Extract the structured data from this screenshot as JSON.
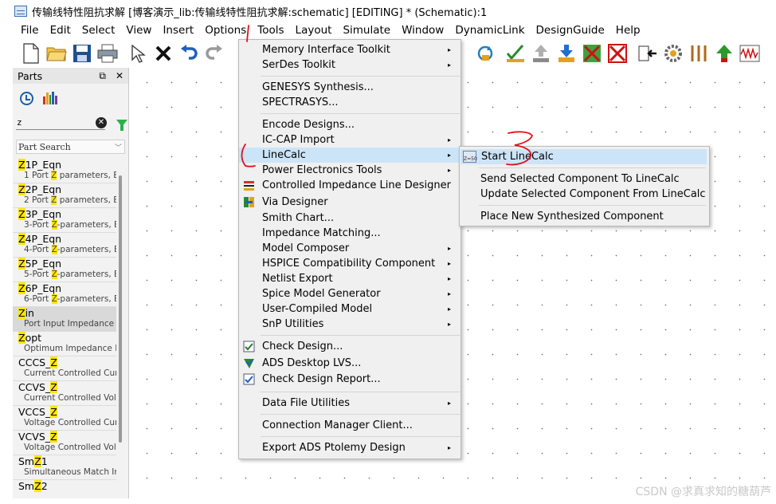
{
  "window": {
    "title": "传输线特性阻抗求解 [博客演示_lib:传输线特性阻抗求解:schematic] [EDITING] * (Schematic):1"
  },
  "menubar": {
    "items": [
      "File",
      "Edit",
      "Select",
      "View",
      "Insert",
      "Options",
      "Tools",
      "Layout",
      "Simulate",
      "Window",
      "DynamicLink",
      "DesignGuide",
      "Help"
    ]
  },
  "toolbar": {
    "icons": [
      "new-document-icon",
      "open-folder-icon",
      "save-icon",
      "print-icon",
      "select-arrow-icon",
      "delete-x-icon",
      "undo-icon",
      "redo-icon",
      "route-icon",
      "checklist-icon",
      "upload-icon",
      "download-icon",
      "deactivate-icon",
      "deactivate-short-icon",
      "export-icon",
      "gear-icon",
      "tuning-icon",
      "push-up-icon",
      "waveform-icon"
    ]
  },
  "parts_panel": {
    "title": "Parts",
    "float_glyph": "⧉",
    "close_glyph": "✕",
    "search_value": "z",
    "part_search_label": "Part Search",
    "items": [
      {
        "pre": "",
        "hl": "Z",
        "post": "1P_Eqn",
        "desc_pre": "1 Port ",
        "desc_hl": "Z",
        "desc_post": " parameters, Eq"
      },
      {
        "pre": "",
        "hl": "Z",
        "post": "2P_Eqn",
        "desc_pre": "2 Port ",
        "desc_hl": "Z",
        "desc_post": " parameters, Eq"
      },
      {
        "pre": "",
        "hl": "Z",
        "post": "3P_Eqn",
        "desc_pre": "3-Port ",
        "desc_hl": "Z",
        "desc_post": "-parameters, Eq"
      },
      {
        "pre": "",
        "hl": "Z",
        "post": "4P_Eqn",
        "desc_pre": "4-Port ",
        "desc_hl": "Z",
        "desc_post": "-parameters, Eq"
      },
      {
        "pre": "",
        "hl": "Z",
        "post": "5P_Eqn",
        "desc_pre": "5-Port ",
        "desc_hl": "Z",
        "desc_post": "-parameters, Eq"
      },
      {
        "pre": "",
        "hl": "Z",
        "post": "6P_Eqn",
        "desc_pre": "6-Port ",
        "desc_hl": "Z",
        "desc_post": "-parameters, Eq"
      },
      {
        "pre": "",
        "hl": "Z",
        "post": "in",
        "desc_pre": "Port Input Impedance",
        "desc_hl": "",
        "desc_post": ""
      },
      {
        "pre": "",
        "hl": "Z",
        "post": "opt",
        "desc_pre": "Optimum Impedance F",
        "desc_hl": "",
        "desc_post": ""
      },
      {
        "pre": "CCCS_",
        "hl": "Z",
        "post": "",
        "desc_pre": "Current Controlled Curr",
        "desc_hl": "",
        "desc_post": ""
      },
      {
        "pre": "CCVS_",
        "hl": "Z",
        "post": "",
        "desc_pre": "Current Controlled Volt",
        "desc_hl": "",
        "desc_post": ""
      },
      {
        "pre": "VCCS_",
        "hl": "Z",
        "post": "",
        "desc_pre": "Voltage Controlled Curr",
        "desc_hl": "",
        "desc_post": ""
      },
      {
        "pre": "VCVS_",
        "hl": "Z",
        "post": "",
        "desc_pre": "Voltage Controlled Volt",
        "desc_hl": "",
        "desc_post": ""
      },
      {
        "pre": "Sm",
        "hl": "Z",
        "post": "1",
        "desc_pre": "Simultaneous Match In",
        "desc_hl": "",
        "desc_post": ""
      },
      {
        "pre": "Sm",
        "hl": "Z",
        "post": "2",
        "desc_pre": "",
        "desc_hl": "",
        "desc_post": ""
      }
    ],
    "selected_index": 6
  },
  "tools_menu": {
    "items": [
      {
        "label": "Memory Interface Toolkit",
        "submenu": true
      },
      {
        "label": "SerDes Toolkit",
        "submenu": true
      },
      {
        "sep": true
      },
      {
        "label": "GENESYS Synthesis...",
        "submenu": false
      },
      {
        "label": "SPECTRASYS...",
        "submenu": false
      },
      {
        "sep": true
      },
      {
        "label": "Encode Designs...",
        "submenu": false
      },
      {
        "label": "IC-CAP Import",
        "submenu": true
      },
      {
        "label": "LineCalc",
        "submenu": true,
        "active": true
      },
      {
        "label": "Power Electronics Tools",
        "submenu": true
      },
      {
        "label": "Controlled Impedance Line Designer",
        "submenu": false,
        "icon": "line-designer-icon"
      },
      {
        "label": "Via Designer",
        "submenu": false,
        "icon": "via-designer-icon"
      },
      {
        "label": "Smith Chart...",
        "submenu": false
      },
      {
        "label": "Impedance Matching...",
        "submenu": false
      },
      {
        "label": "Model Composer",
        "submenu": true
      },
      {
        "label": "HSPICE Compatibility Component",
        "submenu": true
      },
      {
        "label": "Netlist Export",
        "submenu": true
      },
      {
        "label": "Spice Model Generator",
        "submenu": true
      },
      {
        "label": "User-Compiled Model",
        "submenu": true
      },
      {
        "label": "SnP Utilities",
        "submenu": true
      },
      {
        "sep": true
      },
      {
        "label": "Check Design...",
        "submenu": false,
        "icon": "check-design-icon"
      },
      {
        "label": "ADS Desktop LVS...",
        "submenu": false,
        "icon": "lvs-icon"
      },
      {
        "label": "Check Design Report...",
        "submenu": false,
        "icon": "check-report-icon"
      },
      {
        "sep": true
      },
      {
        "label": "Data File Utilities",
        "submenu": true
      },
      {
        "sep": true
      },
      {
        "label": "Connection Manager Client...",
        "submenu": false
      },
      {
        "sep": true
      },
      {
        "label": "Export ADS Ptolemy Design",
        "submenu": true
      }
    ]
  },
  "linecalc_submenu": {
    "icon_text": "Z=50",
    "items": [
      {
        "label": "Start LineCalc",
        "active": true
      },
      {
        "sep": true
      },
      {
        "label": "Send Selected Component To LineCalc"
      },
      {
        "label": "Update Selected Component From LineCalc"
      },
      {
        "sep": true
      },
      {
        "label": "Place New Synthesized Component"
      }
    ]
  },
  "annotations": {
    "step1": "1",
    "step2": "2",
    "step3": "3",
    "color": "#e0111a"
  },
  "watermark": "CSDN @求真求知的糖葫芦"
}
